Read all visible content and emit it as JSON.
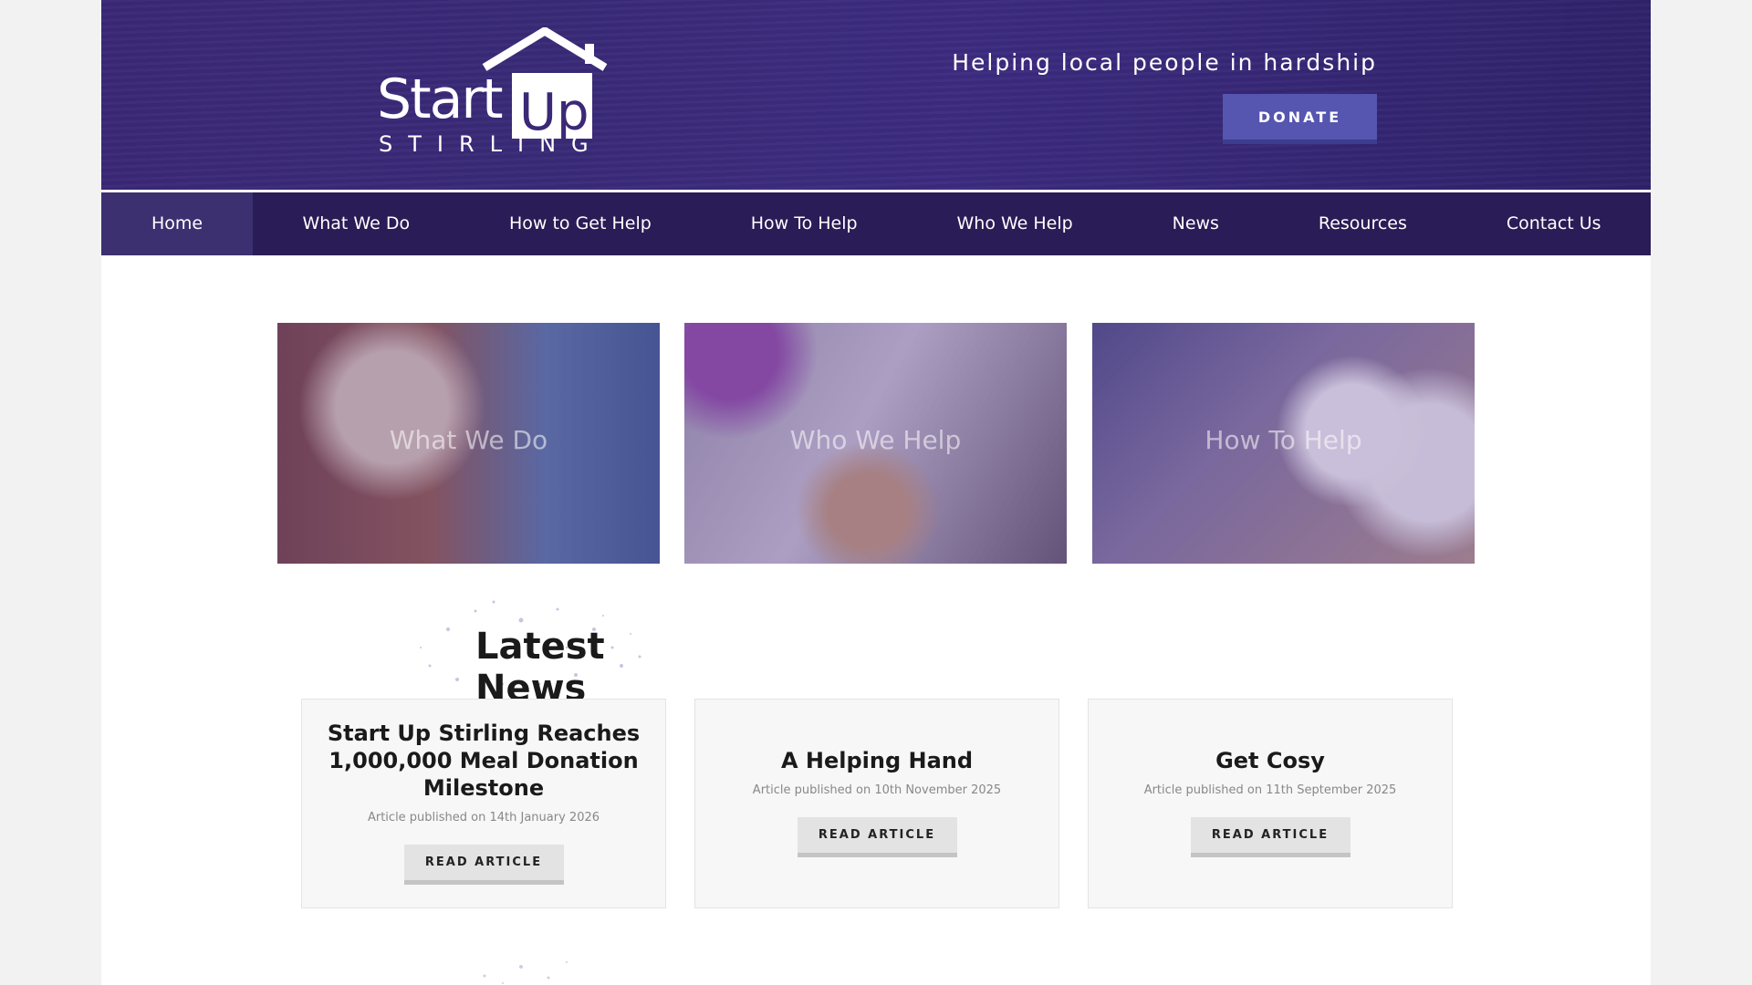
{
  "header": {
    "logo": {
      "word1": "Start",
      "word2": "Up",
      "sub": "STIRLING"
    },
    "tagline": "Helping local people in hardship",
    "donate_label": "DONATE"
  },
  "nav": {
    "items": [
      {
        "label": "Home",
        "active": true
      },
      {
        "label": "What We Do"
      },
      {
        "label": "How to Get Help"
      },
      {
        "label": "How To Help"
      },
      {
        "label": "Who We Help"
      },
      {
        "label": "News"
      },
      {
        "label": "Resources"
      },
      {
        "label": "Contact Us"
      }
    ]
  },
  "tiles": [
    {
      "label": "What We Do",
      "image": "elderly-man-shopping-photo"
    },
    {
      "label": "Who We Help",
      "image": "meal-with-soup-photo"
    },
    {
      "label": "How To Help",
      "image": "donation-box-toilet-rolls-photo"
    }
  ],
  "news": {
    "title": "Latest News",
    "articles": [
      {
        "title": "Start Up Stirling Reaches 1,000,000 Meal Donation Milestone",
        "meta": "Article published on 14th January 2026",
        "button": "READ ARTICLE"
      },
      {
        "title": "A Helping Hand",
        "meta": "Article published on 10th November 2025",
        "button": "READ ARTICLE"
      },
      {
        "title": "Get Cosy",
        "meta": "Article published on 11th September 2025",
        "button": "READ ARTICLE"
      }
    ]
  },
  "colors": {
    "header_purple": "#3b2877",
    "nav_dark": "#2a1c56",
    "donate": "#5655b0"
  }
}
